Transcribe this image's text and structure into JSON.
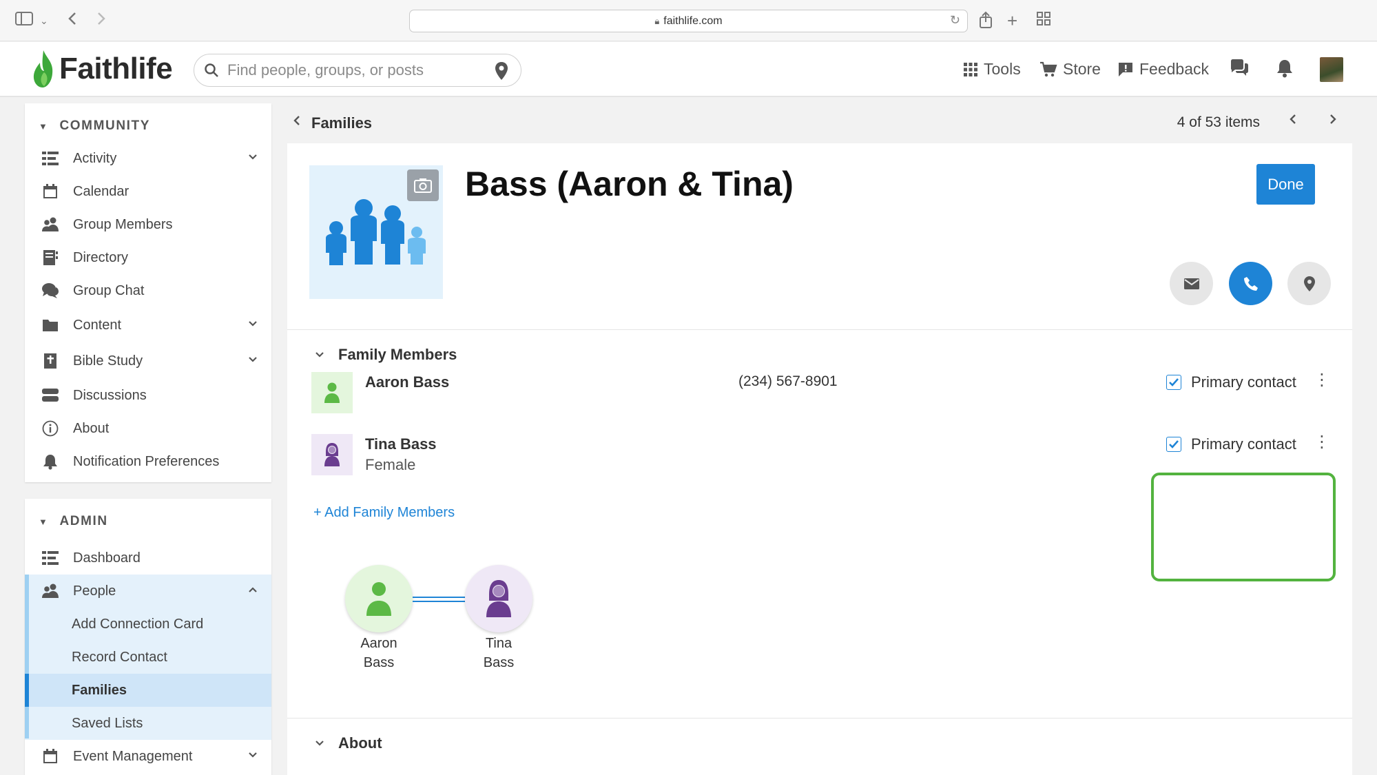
{
  "browser": {
    "url": "faithlife.com"
  },
  "header": {
    "brand": "Faithlife",
    "search_placeholder": "Find people, groups, or posts",
    "nav": {
      "tools": "Tools",
      "store": "Store",
      "feedback": "Feedback"
    }
  },
  "sidebar": {
    "community": {
      "title": "COMMUNITY",
      "items": [
        {
          "label": "Activity",
          "icon": "activity-icon",
          "expandable": true
        },
        {
          "label": "Calendar",
          "icon": "calendar-icon"
        },
        {
          "label": "Group Members",
          "icon": "people-icon"
        },
        {
          "label": "Directory",
          "icon": "directory-icon"
        },
        {
          "label": "Group Chat",
          "icon": "chat-icon"
        },
        {
          "label": "Content",
          "icon": "folder-icon",
          "expandable": true
        },
        {
          "label": "Bible Study",
          "icon": "bible-icon",
          "expandable": true
        },
        {
          "label": "Discussions",
          "icon": "discussions-icon"
        },
        {
          "label": "About",
          "icon": "info-icon"
        },
        {
          "label": "Notification Preferences",
          "icon": "bell-icon"
        }
      ]
    },
    "admin": {
      "title": "ADMIN",
      "items": [
        {
          "label": "Dashboard",
          "icon": "dashboard-icon"
        },
        {
          "label": "People",
          "icon": "people-icon",
          "expanded": true
        },
        {
          "label": "Add Connection Card"
        },
        {
          "label": "Record Contact"
        },
        {
          "label": "Families",
          "active": true
        },
        {
          "label": "Saved Lists"
        },
        {
          "label": "Event Management",
          "icon": "calendar-icon",
          "expandable": true
        }
      ]
    }
  },
  "main": {
    "breadcrumb": "Families",
    "pager": "4 of 53 items",
    "family": {
      "name": "Bass (Aaron & Tina)",
      "done_label": "Done"
    },
    "family_members": {
      "title": "Family Members",
      "members": [
        {
          "name": "Aaron Bass",
          "phone": "(234) 567-8901",
          "gender": "",
          "primary_contact": "Primary contact"
        },
        {
          "name": "Tina Bass",
          "phone": "",
          "gender": "Female",
          "primary_contact": "Primary contact"
        }
      ],
      "add_link": "+ Add Family Members"
    },
    "tree": {
      "nodes": [
        {
          "first": "Aaron",
          "last": "Bass"
        },
        {
          "first": "Tina",
          "last": "Bass"
        }
      ]
    },
    "about": {
      "title": "About"
    }
  },
  "colors": {
    "accent": "#1e84d6",
    "highlight": "#53b33f",
    "brand_green": "#3da83a",
    "female": "#6a3d8f",
    "male": "#5cb946"
  }
}
